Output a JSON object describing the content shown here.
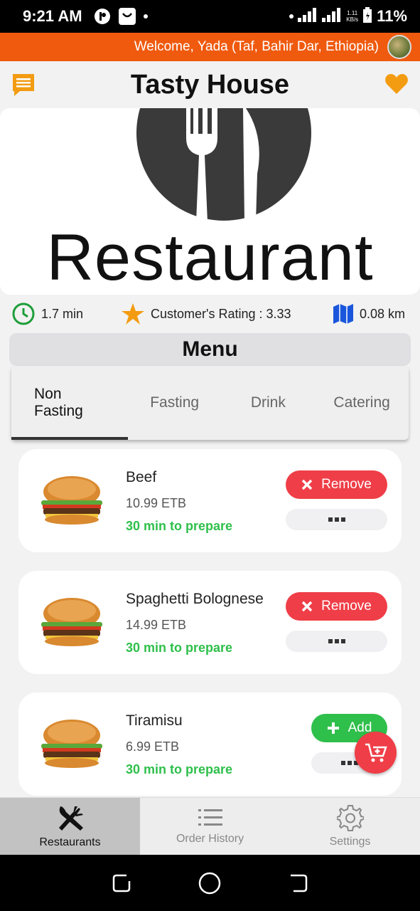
{
  "status_bar": {
    "time": "9:21 AM",
    "net_speed_value": "1.11",
    "net_speed_unit": "KB/s",
    "battery_percent": "11%"
  },
  "welcome": {
    "text": "Welcome, Yada (Taf, Bahir Dar, Ethiopia)"
  },
  "header": {
    "title": "Tasty House",
    "chat_icon": "chat-icon",
    "favorite_icon": "heart-icon",
    "colors": {
      "accent": "#ef5a0f",
      "icon_orange": "#f39c12"
    }
  },
  "hero": {
    "logo_text": "Restaurant"
  },
  "info": {
    "prep_time": "1.7 min",
    "rating": "Customer's Rating : 3.33",
    "distance": "0.08 km"
  },
  "menu": {
    "title": "Menu",
    "tabs": [
      {
        "label_line1": "Non",
        "label_line2": "Fasting",
        "active": true
      },
      {
        "label": "Fasting"
      },
      {
        "label": "Drink"
      },
      {
        "label": "Catering"
      }
    ],
    "items": [
      {
        "name": "Beef",
        "price": "10.99 ETB",
        "prep": "30 min to prepare",
        "action": "Remove"
      },
      {
        "name": "Spaghetti Bolognese",
        "price": "14.99 ETB",
        "prep": "30 min to prepare",
        "action": "Remove"
      },
      {
        "name": "Tiramisu",
        "price": "6.99 ETB",
        "prep": "30 min to prepare",
        "action": "Add"
      }
    ],
    "colors": {
      "remove": "#ef3e47",
      "add": "#2fbf4b",
      "prep": "#2fbf4b"
    }
  },
  "bottom_nav": {
    "items": [
      {
        "label": "Restaurants",
        "icon": "utensils-icon",
        "active": true
      },
      {
        "label": "Order History",
        "icon": "list-icon"
      },
      {
        "label": "Settings",
        "icon": "gear-icon"
      }
    ]
  }
}
